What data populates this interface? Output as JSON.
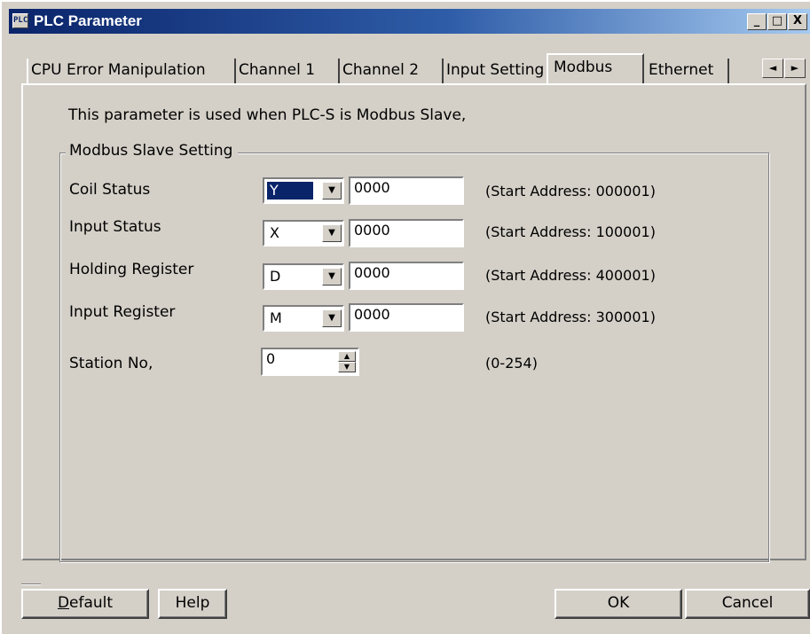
{
  "window": {
    "title": "PLC Parameter",
    "icon_name": "plc-app-icon",
    "icon_text": "PLC",
    "minimize": "_",
    "maximize": "□",
    "close": "X"
  },
  "tabs": {
    "items": [
      {
        "label": "CPU Error Manipulation"
      },
      {
        "label": "Channel 1"
      },
      {
        "label": "Channel 2"
      },
      {
        "label": "Input Setting"
      },
      {
        "label": "Modbus"
      },
      {
        "label": "Ethernet"
      }
    ],
    "active_index": 4,
    "scroll_left": "◄",
    "scroll_right": "►"
  },
  "modbus": {
    "description": "This parameter is used when PLC-S is Modbus Slave,",
    "group_title": "Modbus Slave Setting",
    "rows": [
      {
        "label": "Coil Status",
        "device": "Y",
        "address": "0000",
        "hint": "(Start Address: 000001)"
      },
      {
        "label": "Input Status",
        "device": "X",
        "address": "0000",
        "hint": "(Start Address: 100001)"
      },
      {
        "label": "Holding Register",
        "device": "D",
        "address": "0000",
        "hint": "(Start Address: 400001)"
      },
      {
        "label": "Input Register",
        "device": "M",
        "address": "0000",
        "hint": "(Start Address: 300001)"
      }
    ],
    "station": {
      "label": "Station No,",
      "value": "0",
      "hint": "(0-254)"
    }
  },
  "buttons": {
    "default_label": "Default",
    "default_accel": "D",
    "default_rest": "efault",
    "help_label": "Help",
    "ok_label": "OK",
    "cancel_label": "Cancel"
  },
  "colors": {
    "title_bar": "#0a246a",
    "face": "#d4d0c8",
    "selection": "#0a246a"
  }
}
